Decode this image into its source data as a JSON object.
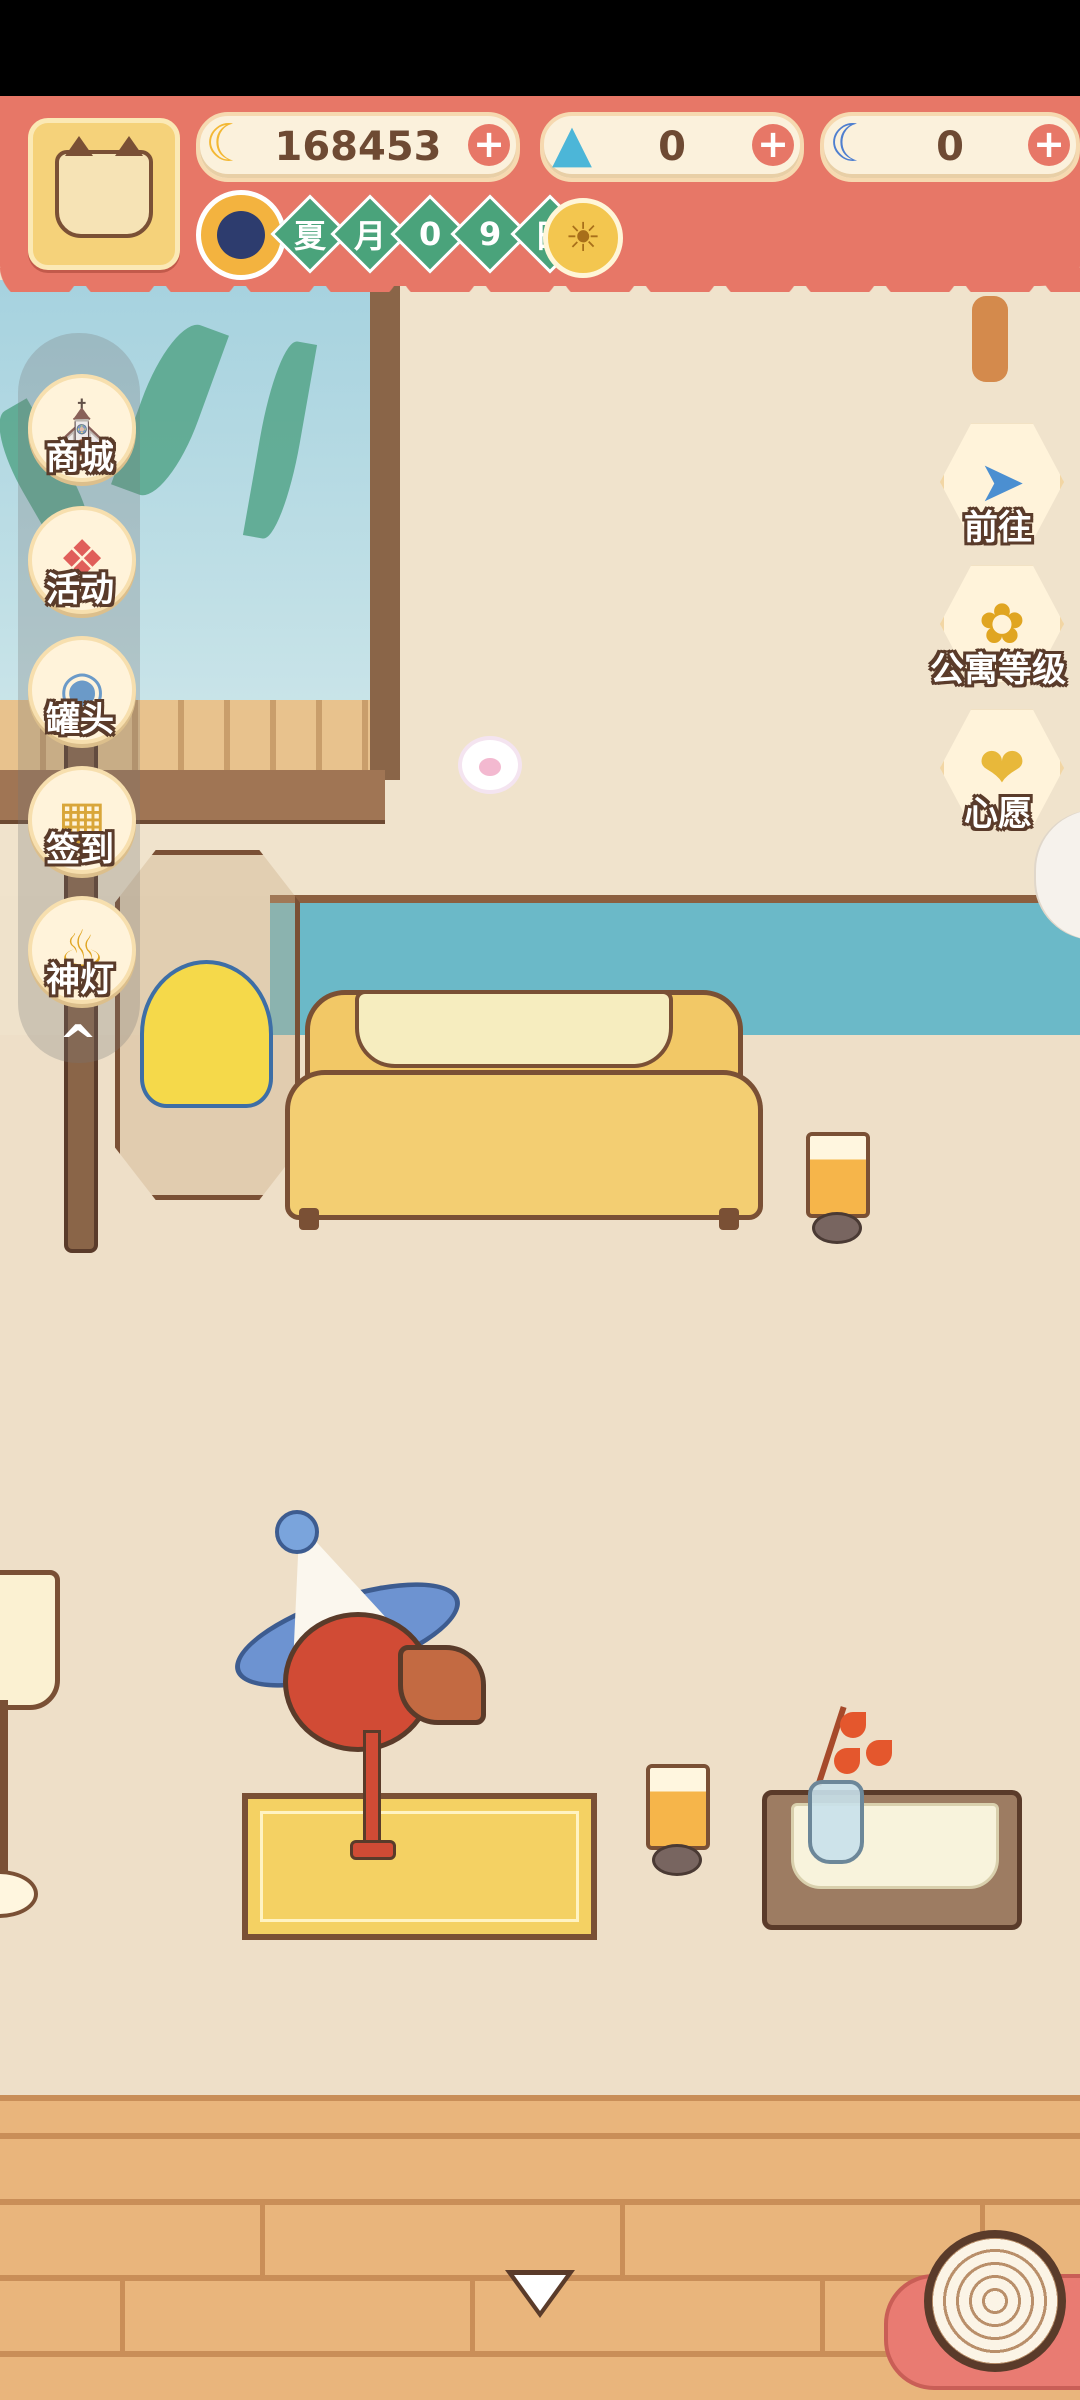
{
  "hud": {
    "currencies": [
      {
        "name": "banana",
        "icon": "banana-icon",
        "value": "168453"
      },
      {
        "name": "flame",
        "icon": "blue-flame-icon",
        "value": "0"
      },
      {
        "name": "blue-banana",
        "icon": "blue-banana-icon",
        "value": "0"
      }
    ],
    "add_label": "+",
    "date": [
      "夏",
      "月",
      "0",
      "9",
      "日"
    ],
    "weather_icon": "sun-icon"
  },
  "left_menu": [
    {
      "label": "商城",
      "icon": "shop-icon"
    },
    {
      "label": "活动",
      "icon": "gift-icon"
    },
    {
      "label": "罐头",
      "icon": "can-icon"
    },
    {
      "label": "签到",
      "icon": "signin-icon"
    },
    {
      "label": "神灯",
      "icon": "magic-lamp-icon"
    }
  ],
  "collapse_label": "^",
  "right_menu": [
    {
      "label": "前往",
      "icon": "map-pin-icon"
    },
    {
      "label": "公寓等级",
      "icon": "cat-badge-icon"
    },
    {
      "label": "心愿",
      "icon": "heart-book-icon"
    }
  ],
  "colors": {
    "hud_red": "#e77767",
    "wall": "#f0e3cc",
    "wainscot": "#6bb9c8",
    "floor_wood": "#e9b57c",
    "outline": "#5a3b2a"
  }
}
